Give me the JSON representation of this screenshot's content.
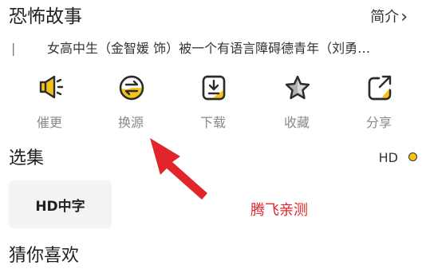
{
  "header": {
    "title": "恐怖故事",
    "intro_label": "简介",
    "intro_chevron": "›"
  },
  "description": {
    "cursor": "|",
    "text": "女高中生（金智媛 饰）被一个有语言障碍德青年（刘勇…"
  },
  "actions": [
    {
      "label": "催更",
      "icon": "megaphone-icon"
    },
    {
      "label": "换源",
      "icon": "switch-source-icon"
    },
    {
      "label": "下载",
      "icon": "download-icon"
    },
    {
      "label": "收藏",
      "icon": "star-icon"
    },
    {
      "label": "分享",
      "icon": "share-icon"
    }
  ],
  "episodes": {
    "title": "选集",
    "quality": "HD",
    "items": [
      "HD中字"
    ]
  },
  "watermark": "腾飞亲测",
  "recommend": {
    "title": "猜你喜欢"
  },
  "colors": {
    "accent": "#f5c21a",
    "annotation": "#e0262b",
    "label_gray": "#8a8a8a"
  }
}
